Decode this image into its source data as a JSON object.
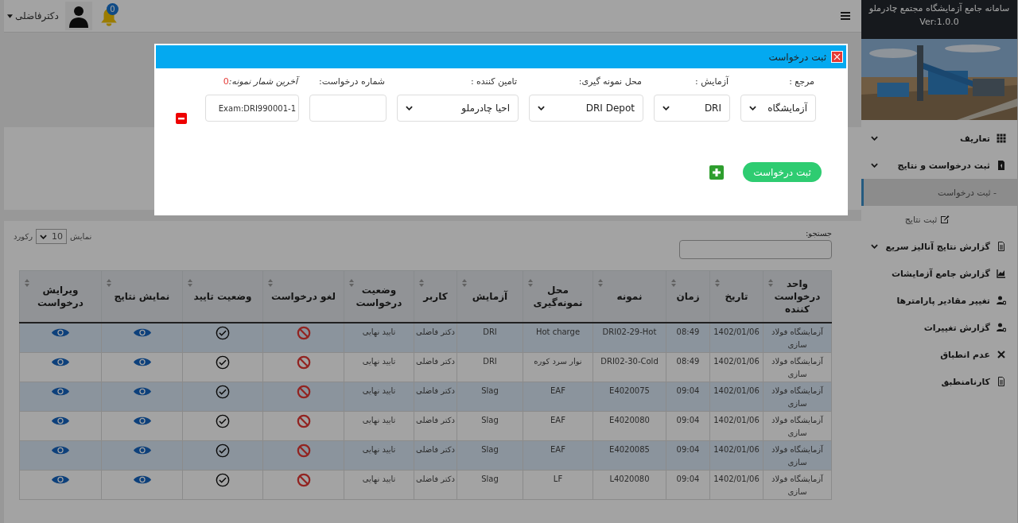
{
  "topbar": {
    "user": "دکترفاضلی",
    "notifications": "0"
  },
  "sidebar": {
    "title": "سامانه جامع آزمایشگاه مجتمع چادرملو",
    "version": "Ver:1.0.0",
    "items": [
      {
        "label": "تعاریف",
        "submenu": true,
        "selected": false
      },
      {
        "label": "ثبت درخواست و نتایج",
        "submenu": true,
        "selected": false,
        "children": [
          {
            "label": "- ثبت درخواست",
            "selected": true
          },
          {
            "label": "ثبت نتایج",
            "selected": false
          }
        ]
      },
      {
        "label": "گزارش نتایج آنالیز سریع",
        "submenu": true,
        "selected": false
      },
      {
        "label": "گزارش جامع آزمایشات",
        "submenu": false,
        "selected": false
      },
      {
        "label": "تغییر مقادیر پارامترها",
        "submenu": false,
        "selected": false
      },
      {
        "label": "گزارش تغییرات",
        "submenu": false,
        "selected": false
      },
      {
        "label": "عدم انطباق",
        "submenu": false,
        "selected": false
      },
      {
        "label": "کارنامنطبق",
        "submenu": false,
        "selected": false
      }
    ]
  },
  "table_controls": {
    "show_label": "نمایش",
    "page_size": "10",
    "records_label": "رکورد",
    "search_label": "جستجو:"
  },
  "table": {
    "columns": [
      "واحد درخواست کننده",
      "تاریخ",
      "زمان",
      "نمونه",
      "محل نمونه‌گیری",
      "آزمایش",
      "کاربر",
      "وضعیت درخواست",
      "لغو درخواست",
      "وضعیت تایید",
      "نمایش نتایج",
      "ویرایش درخواست"
    ],
    "rows": [
      {
        "unit": "آزمایشگاه فولاد سازی",
        "date": "1402/01/06",
        "time": "08:49",
        "sample": "DRI02-29-Hot",
        "location": "Hot charge",
        "test": "DRI",
        "user": "دکتر فاضلی",
        "status": "تایید نهایی",
        "approved": true
      },
      {
        "unit": "آزمایشگاه فولاد سازی",
        "date": "1402/01/06",
        "time": "08:49",
        "sample": "DRI02-30-Cold",
        "location": "نوار سرد کوره",
        "test": "DRI",
        "user": "دکتر فاضلی",
        "status": "تایید نهایی",
        "approved": true
      },
      {
        "unit": "آزمایشگاه فولاد سازی",
        "date": "1402/01/06",
        "time": "09:04",
        "sample": "E4020075",
        "location": "EAF",
        "test": "Slag",
        "user": "دکتر فاضلی",
        "status": "تایید نهایی",
        "approved": true
      },
      {
        "unit": "آزمایشگاه فولاد سازی",
        "date": "1402/01/06",
        "time": "09:04",
        "sample": "E4020080",
        "location": "EAF",
        "test": "Slag",
        "user": "دکتر فاضلی",
        "status": "تایید نهایی",
        "approved": true
      },
      {
        "unit": "آزمایشگاه فولاد سازی",
        "date": "1402/01/06",
        "time": "09:04",
        "sample": "E4020085",
        "location": "EAF",
        "test": "Slag",
        "user": "دکتر فاضلی",
        "status": "تایید نهایی",
        "approved": true
      },
      {
        "unit": "آزمایشگاه فولاد سازی",
        "date": "1402/01/06",
        "time": "09:04",
        "sample": "L4020080",
        "location": "LF",
        "test": "Slag",
        "user": "دکتر فاضلی",
        "status": "تایید نهایی",
        "approved": true
      }
    ]
  },
  "modal": {
    "title": "ثبت درخواست",
    "fields": [
      {
        "kind": "select",
        "label": "مرجع :",
        "value": "آزمایشگاه"
      },
      {
        "kind": "select",
        "label": "آزمایش :",
        "value": "DRI"
      },
      {
        "kind": "select",
        "label": "محل نمونه گیری:",
        "value": "DRI Depot"
      },
      {
        "kind": "select",
        "label": "تامین کننده :",
        "value": "احیا چادرملو"
      },
      {
        "kind": "input",
        "label": "شماره درخواست:"
      },
      {
        "kind": "input",
        "label": "آخرین شمار نمونه:",
        "count": "0",
        "value": "Exam:DRI990001-1"
      }
    ],
    "submit": "ثبت درخواست"
  }
}
